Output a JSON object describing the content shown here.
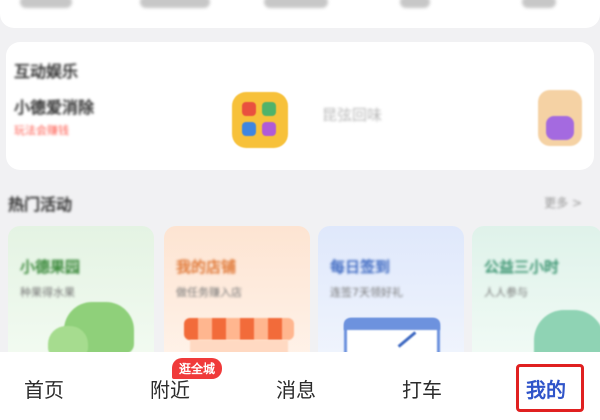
{
  "interactive_section": {
    "title": "互动娱乐",
    "game1": {
      "name": "小德爱消除",
      "subtitle": "玩法会赚钱",
      "icon": "puzzle-tiles-icon"
    },
    "game2": {
      "name": "昆弦回味",
      "icon": "character-game-icon"
    }
  },
  "hot_events": {
    "title": "热门活动",
    "more": "更多 >",
    "cards": [
      {
        "title": "小德果园",
        "subtitle": "种果得水果",
        "theme": "#3c8a3c"
      },
      {
        "title": "我的店铺",
        "subtitle": "做任务赚入店",
        "theme": "#e07a3a"
      },
      {
        "title": "每日签到",
        "subtitle": "连签7天领好礼",
        "theme": "#3f6ac2"
      },
      {
        "title": "公益三小时",
        "subtitle": "人人参与",
        "theme": "#3a9470"
      }
    ]
  },
  "tabbar": {
    "items": [
      {
        "label": "首页"
      },
      {
        "label": "附近",
        "badge": "逛全城"
      },
      {
        "label": "消息"
      },
      {
        "label": "打车"
      },
      {
        "label": "我的",
        "active": true
      }
    ],
    "active_color": "#2f54c9",
    "badge_color": "#f03a3a",
    "highlight_color": "#e02020"
  }
}
